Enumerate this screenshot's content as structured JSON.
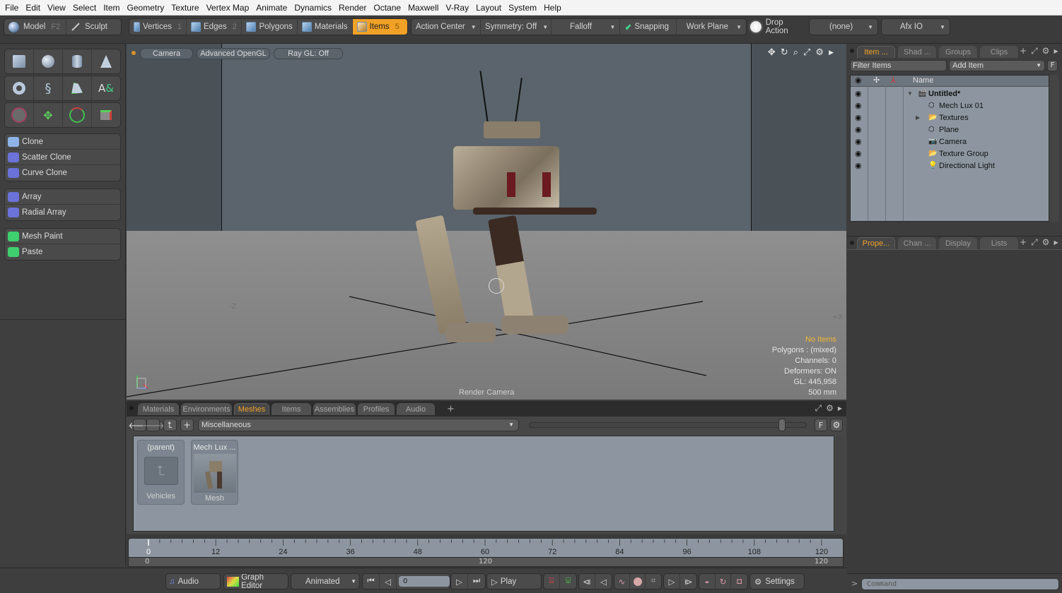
{
  "menu": [
    "File",
    "Edit",
    "View",
    "Select",
    "Item",
    "Geometry",
    "Texture",
    "Vertex Map",
    "Animate",
    "Dynamics",
    "Render",
    "Octane",
    "Maxwell",
    "V-Ray",
    "Layout",
    "System",
    "Help"
  ],
  "toolbar": {
    "mode": {
      "model_label": "Model",
      "model_key": "F2",
      "sculpt_label": "Sculpt"
    },
    "selection_modes": [
      {
        "label": "Vertices",
        "key": "1"
      },
      {
        "label": "Edges",
        "key": "2"
      },
      {
        "label": "Polygons",
        "key": ""
      },
      {
        "label": "Materials",
        "key": ""
      },
      {
        "label": "Items",
        "key": "5",
        "active": true
      }
    ],
    "action_center": "Action Center",
    "symmetry": "Symmetry: Off",
    "falloff": "Falloff",
    "snapping": "Snapping",
    "work_plane": "Work Plane",
    "drop_action": "Drop Action",
    "drop_value": "(none)",
    "afx": "Afx IO"
  },
  "left_panel": {
    "primitives": [
      "cube",
      "sphere",
      "cylinder",
      "cone",
      "torus",
      "spiral",
      "pen",
      "text"
    ],
    "transforms": [
      "transform",
      "move",
      "rotate",
      "scale"
    ],
    "group1": [
      "Clone",
      "Scatter Clone",
      "Curve Clone"
    ],
    "group2": [
      "Array",
      "Radial Array"
    ],
    "group3": [
      "Mesh Paint",
      "Paste"
    ]
  },
  "viewport": {
    "camera": "Camera",
    "shading": "Advanced OpenGL",
    "raygl": "Ray GL: Off",
    "label_bottom": "Render Camera",
    "axis_neg_z": "-Z",
    "axis_pos_x": "+X",
    "info": {
      "selection": "No Items",
      "polygons": "Polygons : (mixed)",
      "channels": "Channels: 0",
      "deformers": "Deformers: ON",
      "gl": "GL: 445,958",
      "scale": "500 mm"
    },
    "selection_color": "#f0b830"
  },
  "right_panel": {
    "top_tabs": [
      "Item ...",
      "Shad ...",
      "Groups",
      "Clips"
    ],
    "filter_placeholder": "Filter Items",
    "add_item": "Add Item",
    "f_button": "F",
    "col_name": "Name",
    "items": [
      {
        "name": "Untitled*",
        "icon": "scene",
        "bold": true,
        "expander": "down"
      },
      {
        "name": "Mech Lux 01",
        "icon": "mesh"
      },
      {
        "name": "Textures",
        "icon": "folder",
        "expander": "right"
      },
      {
        "name": "Plane",
        "icon": "mesh"
      },
      {
        "name": "Camera",
        "icon": "camera"
      },
      {
        "name": "Texture Group",
        "icon": "folder"
      },
      {
        "name": "Directional Light",
        "icon": "light"
      }
    ],
    "bottom_tabs": [
      "Prope...",
      "Chan ...",
      "Display",
      "Lists"
    ]
  },
  "browser": {
    "tabs": [
      "Materials",
      "Environments",
      "Meshes",
      "Items",
      "Assemblies",
      "Profiles",
      "Audio"
    ],
    "active_tab": "Meshes",
    "path": "Miscellaneous",
    "f_button": "F",
    "thumbs": [
      {
        "title": "(parent)",
        "caption": "Vehicles"
      },
      {
        "title": "Mech Lux ...",
        "caption": "Mesh"
      }
    ]
  },
  "timeline": {
    "ticks": [
      "0",
      "12",
      "24",
      "36",
      "48",
      "60",
      "72",
      "84",
      "96",
      "108",
      "120"
    ],
    "range_start": "0",
    "range_mid": "120",
    "range_end": "120"
  },
  "transport": {
    "audio": "Audio",
    "graph_editor": "Graph Editor",
    "animated": "Animated",
    "frame": "0",
    "play": "Play",
    "settings": "Settings"
  },
  "command": {
    "placeholder": "Command",
    "prompt": ">"
  }
}
